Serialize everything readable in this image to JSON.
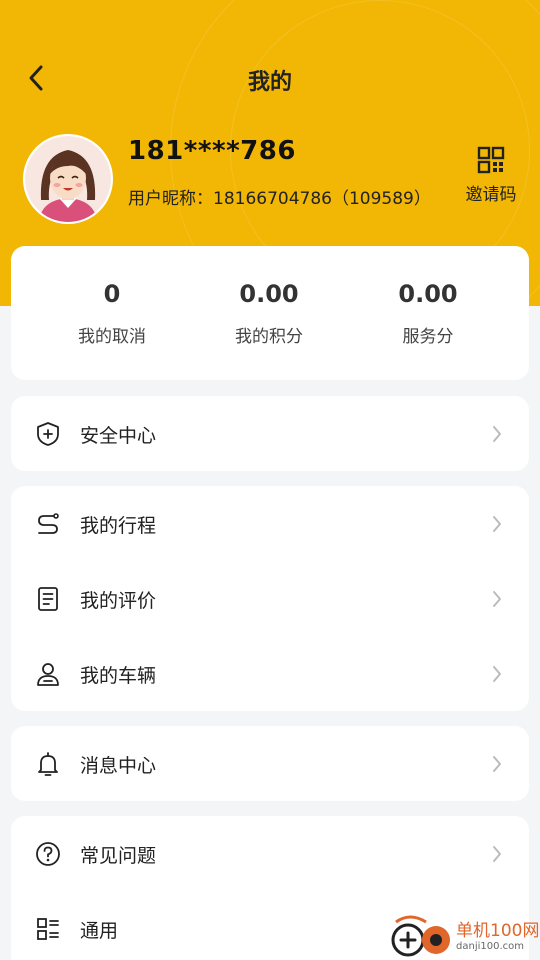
{
  "header": {
    "title": "我的"
  },
  "profile": {
    "phone": "181****786",
    "nickname": "用户昵称：18166704786（109589）",
    "invite_label": "邀请码"
  },
  "stats": [
    {
      "value": "0",
      "label": "我的取消"
    },
    {
      "value": "0.00",
      "label": "我的积分"
    },
    {
      "value": "0.00",
      "label": "服务分"
    }
  ],
  "menu": {
    "security": "安全中心",
    "trips": "我的行程",
    "reviews": "我的评价",
    "vehicles": "我的车辆",
    "messages": "消息中心",
    "faq": "常见问题",
    "general": "通用"
  },
  "watermark": {
    "name": "单机100网",
    "url": "danji100.com"
  },
  "colors": {
    "brand": "#f2b705",
    "background": "#f4f5f7",
    "card": "#ffffff"
  }
}
